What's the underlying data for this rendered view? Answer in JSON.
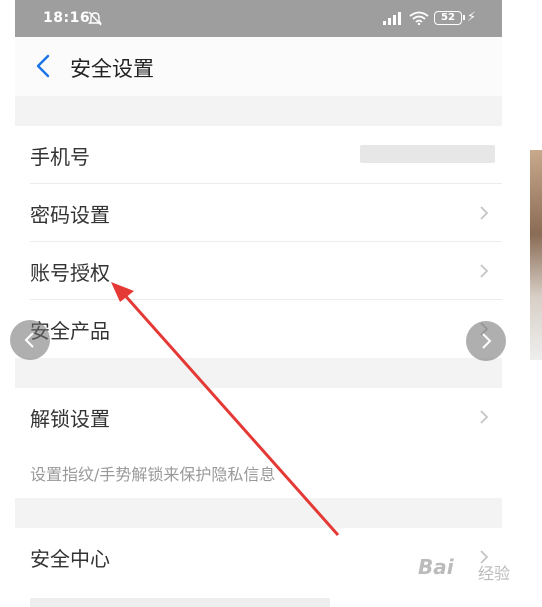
{
  "status_bar": {
    "time": "18:16",
    "battery": "52"
  },
  "header": {
    "title": "安全设置"
  },
  "section1": {
    "items": [
      {
        "label": "手机号"
      },
      {
        "label": "密码设置"
      },
      {
        "label": "账号授权"
      },
      {
        "label": "安全产品"
      }
    ]
  },
  "section2": {
    "label": "解锁设置",
    "hint": "设置指纹/手势解锁来保护隐私信息"
  },
  "section3": {
    "label": "安全中心"
  },
  "watermark": {
    "brand": "Bai",
    "brand_cn": "经验"
  },
  "colors": {
    "accent": "#1a73e8",
    "annotation": "#e53935"
  }
}
